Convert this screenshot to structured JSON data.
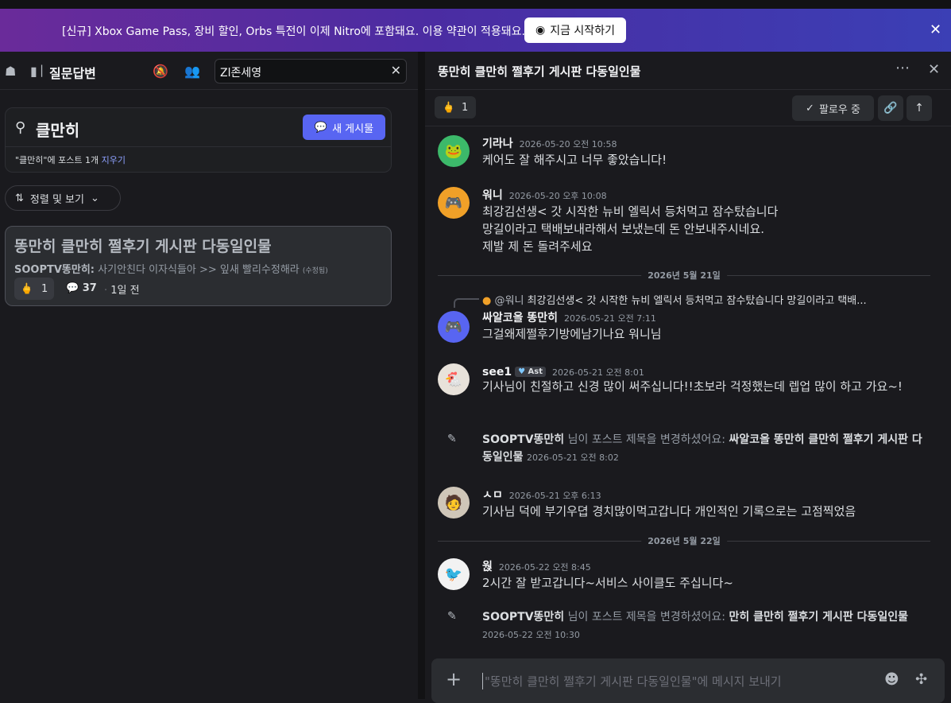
{
  "banner": {
    "text": "[신규] Xbox Game Pass, 장비 할인, Orbs 특전이 이제 Nitro에 포함돼요. 이용 약관이 적용돼요.",
    "button_label": "지금 시작하기",
    "close": "✕"
  },
  "left_header": {
    "channel_name": "질문답변",
    "search_value": "Zl존세영",
    "clear": "✕"
  },
  "search": {
    "query": "클만히",
    "new_post_label": "새 게시물",
    "result_count_text": "\"클만히\"에 포스트 1개",
    "clear_label": "지우기"
  },
  "sort": {
    "label": "정렬 및 보기"
  },
  "post_card": {
    "title": "똥만히 클만히 쩔후기 게시판 다동일인물",
    "author": "SOOPTV똥만히:",
    "preview": " 사기안친다 이자식들아 >> 잎새 빨리수정해라",
    "edited": "(수정됨)",
    "reaction_emoji": "🖕",
    "reaction_count": "1",
    "comment_count": "37",
    "time": "1일 전"
  },
  "thread": {
    "title": "똥만히 클만히 쩔후기 게시판 다동일인물",
    "reaction_emoji": "🖕",
    "reaction_count": "1",
    "follow_label": "팔로우 중"
  },
  "messages": [
    {
      "author": "기라나",
      "time": "2026-05-20 오전 10:58",
      "text": "케어도 잘 해주시고 너무 좋았습니다!"
    },
    {
      "author": "워니",
      "time": "2026-05-20 오후 10:08",
      "text": "최강김선생< 갓 시작한 뉴비 엘릭서 등처먹고 잠수탔습니다\n망길이라고 택배보내라해서 보냈는데 돈 안보내주시네요.\n제발 제 돈 돌려주세요"
    },
    {
      "date": "2026년 5월 21일"
    },
    {
      "reply_to": "@워니",
      "reply_text": "최강김선생< 갓 시작한 뉴비 엘릭서 등처먹고 잠수탔습니다 망길이라고 택배...",
      "author": "싸알코올 똥만히",
      "time": "2026-05-21 오전 7:11",
      "text": "그걸왜제쩔후기방에남기나요 워니님"
    },
    {
      "author": "see1",
      "tag": "Ast",
      "time": "2026-05-21 오전 8:01",
      "text": "기사님이 친절하고 신경 많이 써주십니다!!초보라 걱정했는데 렙업 많이 하고 가요~!"
    },
    {
      "system_author": "SOOPTV똥만히",
      "system_text": " 님이 포스트 제목을 변경하셨어요: ",
      "system_new_title": "싸알코올 똥만히 클만히 쩔후기 게시판 다동일인물",
      "time": "2026-05-21 오전 8:02"
    },
    {
      "author": "ㅅㅁ",
      "time": "2026-05-21 오후 6:13",
      "text": "기사님 덕에 부기우뎝 경치많이먹고갑니다 개인적인 기록으로는 고점찍었음"
    },
    {
      "date": "2026년 5월 22일"
    },
    {
      "author": "웑",
      "time": "2026-05-22 오전 8:45",
      "text": "2시간 잘 받고갑니다~서비스 사이클도 주십니다~"
    },
    {
      "system_author": "SOOPTV똥만히",
      "system_text": " 님이 포스트 제목을 변경하셨어요: ",
      "system_new_title": "만히 클만히 쩔후기 게시판 다동일인물",
      "time": "2026-05-22 오전 10:30"
    }
  ],
  "composer": {
    "placeholder": "\"똥만히 클만히 쩔후기 게시판 다동일인물\"에 메시지 보내기"
  },
  "colors": {
    "accent": "#5865f2",
    "banner_start": "#6a2b9a",
    "banner_end": "#3b3fb5",
    "discord_blue": "#5865f2",
    "discord_orange": "#f0a028"
  }
}
